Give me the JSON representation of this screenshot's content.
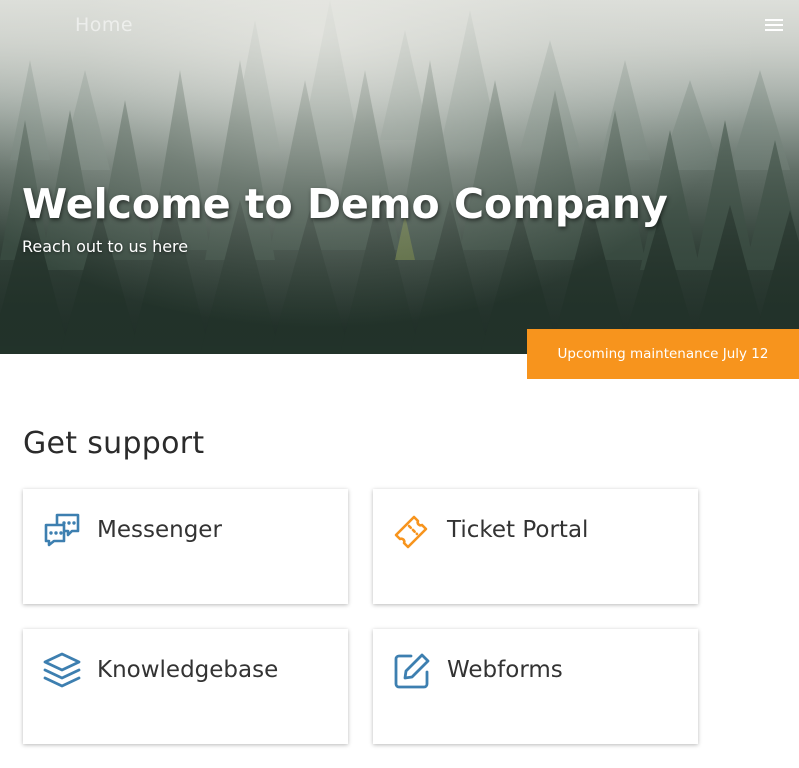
{
  "nav": {
    "home_label": "Home",
    "menu_icon": "hamburger-menu-icon"
  },
  "hero": {
    "title": "Welcome to Demo Company",
    "subtitle": "Reach out to us here",
    "background": "misty-forest"
  },
  "banner": {
    "text": "Upcoming maintenance July 12",
    "color": "#f7941d"
  },
  "support": {
    "title": "Get support",
    "cards": [
      {
        "label": "Messenger",
        "icon": "chat-bubbles-icon",
        "color": "#3d7fb0"
      },
      {
        "label": "Ticket Portal",
        "icon": "ticket-icon",
        "color": "#f7941d"
      },
      {
        "label": "Knowledgebase",
        "icon": "layers-icon",
        "color": "#3d7fb0"
      },
      {
        "label": "Webforms",
        "icon": "edit-form-icon",
        "color": "#3d7fb0"
      }
    ]
  }
}
